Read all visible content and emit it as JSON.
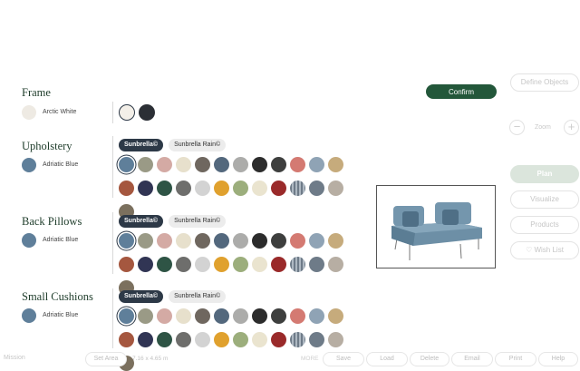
{
  "frame": {
    "title": "Frame",
    "current": "Arctic White",
    "current_color": "#eeeae3",
    "swatches": [
      "#f3efe8",
      "#2b2f35"
    ],
    "selected_index": 0
  },
  "confirm_label": "Confirm",
  "sections": [
    {
      "key": "upholstery",
      "title": "Upholstery",
      "current": "Adriatic Blue",
      "current_color": "#5f7f9a",
      "tabs": [
        "Sunbrella©",
        "Sunbrella Rain©"
      ]
    },
    {
      "key": "back_pillows",
      "title": "Back Pillows",
      "current": "Adriatic Blue",
      "current_color": "#5f7f9a",
      "tabs": [
        "Sunbrella©",
        "Sunbrella Rain©"
      ]
    },
    {
      "key": "small_cushions",
      "title": "Small Cushions",
      "current": "Adriatic Blue",
      "current_color": "#5f7f9a",
      "tabs": [
        "Sunbrella©",
        "Sunbrella Rain©"
      ]
    }
  ],
  "swatch_colors": [
    "#5f7f9a",
    "#9a9a86",
    "#d4aaa4",
    "#e7e0cc",
    "#6f675f",
    "#53687d",
    "#acacaa",
    "#2c2c2c",
    "#3e3f3e",
    "#d47a72",
    "#8fa3b5",
    "#c6ab7c",
    "#a5573f",
    "#313554",
    "#2e5445",
    "#6e6e6c",
    "#d3d3d3",
    "#e0a12e",
    "#9cae7c",
    "#eae4cf",
    "#9a2a2a",
    "#7f8c99",
    "#6e7b88",
    "#b7aea3",
    "#7b705e"
  ],
  "right_panel": {
    "define_objects": "Define Objects",
    "zoom_label": "Zoom",
    "zoom_out": "−",
    "zoom_in": "+",
    "buttons": [
      "Plan",
      "Visualize",
      "Products",
      "Wish List"
    ]
  },
  "bottom_bar": {
    "left_label": "Mission",
    "set_area": "Set Area",
    "dimensions": "7.16 x 4.65 m",
    "mid_label": "MORE",
    "buttons": [
      "Save",
      "Load",
      "Delete",
      "Email",
      "Print",
      "Help"
    ]
  }
}
